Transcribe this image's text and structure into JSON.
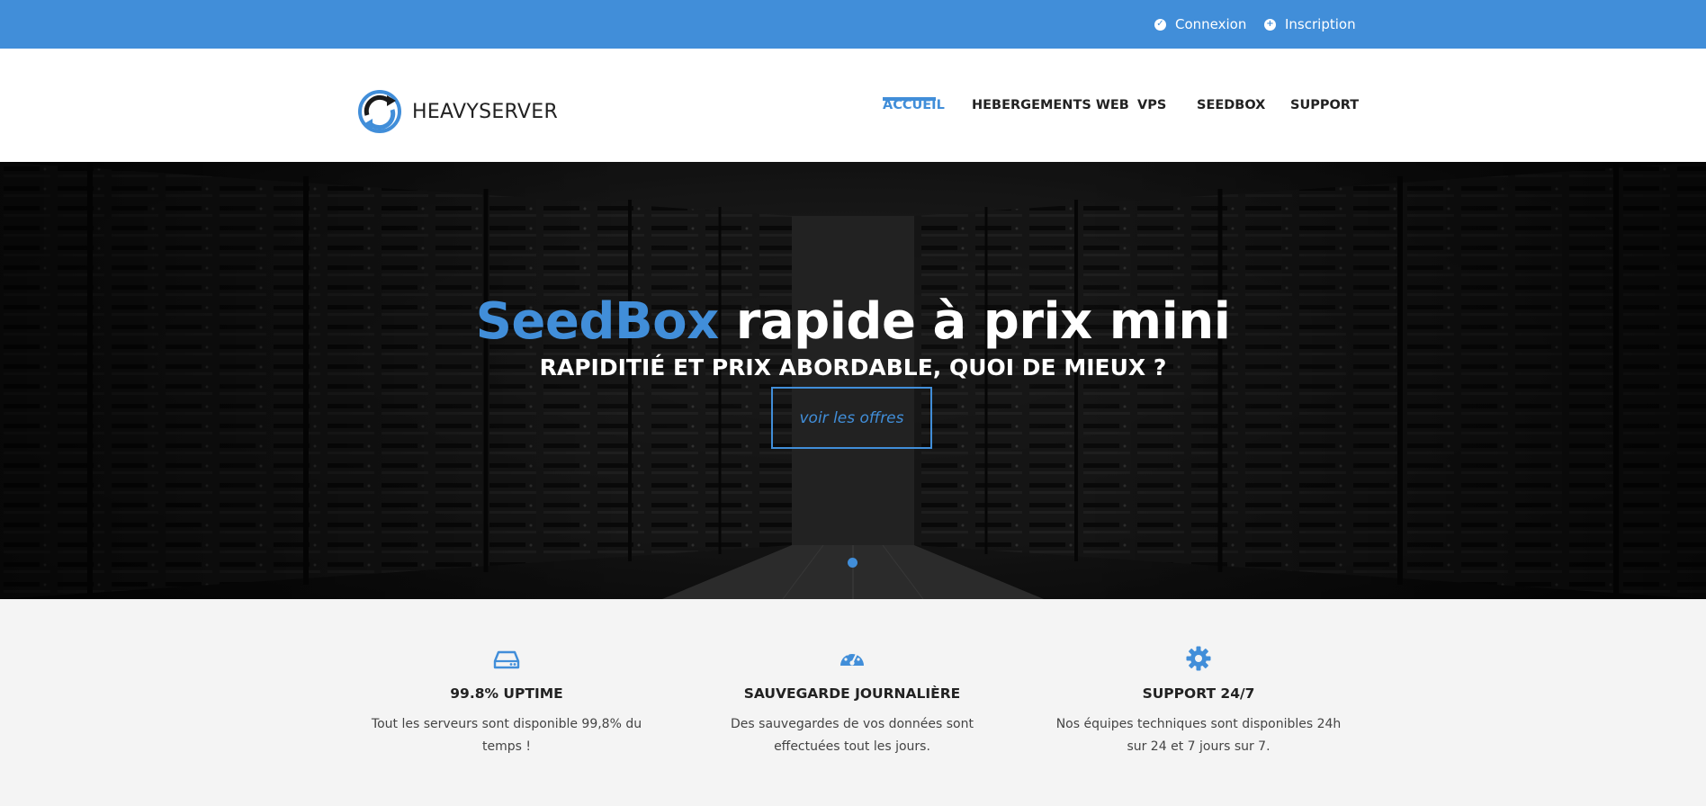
{
  "topbar": {
    "links": [
      {
        "label": "Connexion",
        "icon": "check-circle-icon"
      },
      {
        "label": "Inscription",
        "icon": "plus-circle-icon"
      }
    ],
    "color": "#418ed9"
  },
  "header": {
    "logo_text": "HEAVYSERVER",
    "nav": [
      {
        "label": "ACCUEIL",
        "active": true
      },
      {
        "label": "HEBERGEMENTS WEB",
        "active": false
      },
      {
        "label": "VPS",
        "active": false
      },
      {
        "label": "SEEDBOX",
        "active": false
      },
      {
        "label": "SUPPORT",
        "active": false
      }
    ]
  },
  "hero": {
    "title_accent": "SeedBox",
    "title_rest": " rapide à prix mini",
    "subtitle": "RAPIDITIÉ ET PRIX ABORDABLE, QUOI DE MIEUX ?",
    "button": "voir les offres",
    "slides": 1,
    "active_slide": 1
  },
  "features": [
    {
      "icon": "hard-drive-icon",
      "title": "99.8% UPTIME",
      "text": "Tout les serveurs sont disponible 99,8% du temps !"
    },
    {
      "icon": "speedometer-icon",
      "title": "SAUVEGARDE JOURNALIÈRE",
      "text": "Des sauvegardes de vos données sont effectuées tout les jours."
    },
    {
      "icon": "gear-icon",
      "title": "SUPPORT 24/7",
      "text": "Nos équipes techniques sont disponibles 24h sur 24 et 7 jours sur 7."
    }
  ],
  "colors": {
    "accent": "#418ed9",
    "features_bg": "#f4f4f4"
  }
}
